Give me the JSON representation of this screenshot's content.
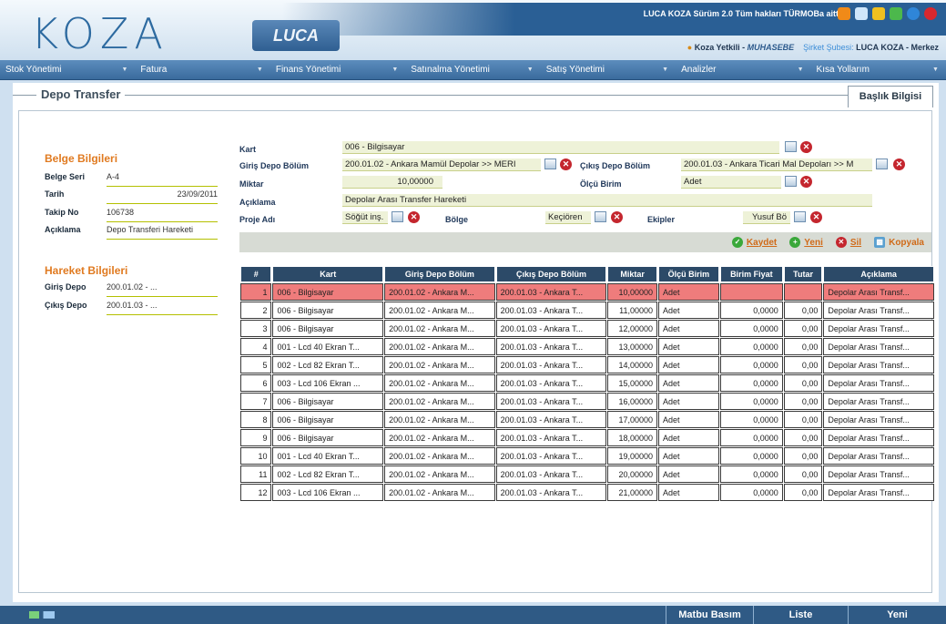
{
  "header": {
    "logo_text": "KOZA",
    "luca_text": "LUCA",
    "copyright": "LUCA KOZA Sürüm 2.0 Tüm hakları TÜRMOBa aittir.",
    "user_name": "Koza Yetkili",
    "user_role": "MUHASEBE",
    "branch_label": "Şirket Şubesi:",
    "branch_value": "LUCA KOZA - Merkez",
    "colors": {
      "brand": "#2d6aa0",
      "bar": "#2a5f95",
      "accent": "#e07a20",
      "selected_row": "#ef7c7c"
    }
  },
  "menu": [
    {
      "label": "Stok Yönetimi"
    },
    {
      "label": "Fatura"
    },
    {
      "label": "Finans Yönetimi"
    },
    {
      "label": "Satınalma Yönetimi"
    },
    {
      "label": "Satış Yönetimi"
    },
    {
      "label": "Analizler"
    },
    {
      "label": "Kısa Yollarım"
    }
  ],
  "page": {
    "title": "Depo Transfer",
    "header_tab": "Başlık Bilgisi"
  },
  "belge": {
    "section_title": "Belge Bilgileri",
    "seri_label": "Belge Seri",
    "seri_value": "A-4",
    "tarih_label": "Tarih",
    "tarih_value": "23/09/2011",
    "takip_label": "Takip No",
    "takip_value": "106738",
    "aciklama_label": "Açıklama",
    "aciklama_value": "Depo Transferi Hareketi"
  },
  "hareket": {
    "section_title": "Hareket Bilgileri",
    "giris_label": "Giriş Depo",
    "giris_value": "200.01.02 - ...",
    "cikis_label": "Çıkış Depo",
    "cikis_value": "200.01.03 - ..."
  },
  "form": {
    "kart_label": "Kart",
    "kart_value": "006 - Bilgisayar",
    "giris_label": "Giriş Depo Bölüm",
    "giris_value": "200.01.02 - Ankara Mamül Depolar >> MERI",
    "cikis_label": "Çıkış Depo Bölüm",
    "cikis_value": "200.01.03 - Ankara Ticari Mal Depoları >> M",
    "miktar_label": "Miktar",
    "miktar_value": "10,00000",
    "olcu_label": "Ölçü Birim",
    "olcu_value": "Adet",
    "aciklama_label": "Açıklama",
    "aciklama_value": "Depolar Arası Transfer Hareketi",
    "proje_label": "Proje Adı",
    "proje_value": "Söğüt inş.",
    "bolge_label": "Bölge",
    "bolge_value": "Keçiören",
    "ekip_label": "Ekipler",
    "ekip_value": "Yusuf Bö"
  },
  "actions": {
    "kaydet": "Kaydet",
    "yeni": "Yeni",
    "sil": "Sil",
    "kopyala": "Kopyala"
  },
  "table": {
    "columns": [
      "#",
      "Kart",
      "Giriş Depo Bölüm",
      "Çıkış Depo Bölüm",
      "Miktar",
      "Ölçü Birim",
      "Birim Fiyat",
      "Tutar",
      "Açıklama"
    ],
    "rows": [
      {
        "no": "1",
        "kart": "006 - Bilgisayar",
        "giris": "200.01.02 - Ankara M...",
        "cikis": "200.01.03 - Ankara T...",
        "miktar": "10,00000",
        "olcu": "Adet",
        "fiyat": "",
        "tutar": "",
        "aciklama": "Depolar Arası Transf..."
      },
      {
        "no": "2",
        "kart": "006 - Bilgisayar",
        "giris": "200.01.02 - Ankara M...",
        "cikis": "200.01.03 - Ankara T...",
        "miktar": "11,00000",
        "olcu": "Adet",
        "fiyat": "0,0000",
        "tutar": "0,00",
        "aciklama": "Depolar Arası Transf..."
      },
      {
        "no": "3",
        "kart": "006 - Bilgisayar",
        "giris": "200.01.02 - Ankara M...",
        "cikis": "200.01.03 - Ankara T...",
        "miktar": "12,00000",
        "olcu": "Adet",
        "fiyat": "0,0000",
        "tutar": "0,00",
        "aciklama": "Depolar Arası Transf..."
      },
      {
        "no": "4",
        "kart": "001 - Lcd 40 Ekran T...",
        "giris": "200.01.02 - Ankara M...",
        "cikis": "200.01.03 - Ankara T...",
        "miktar": "13,00000",
        "olcu": "Adet",
        "fiyat": "0,0000",
        "tutar": "0,00",
        "aciklama": "Depolar Arası Transf..."
      },
      {
        "no": "5",
        "kart": "002 - Lcd 82 Ekran T...",
        "giris": "200.01.02 - Ankara M...",
        "cikis": "200.01.03 - Ankara T...",
        "miktar": "14,00000",
        "olcu": "Adet",
        "fiyat": "0,0000",
        "tutar": "0,00",
        "aciklama": "Depolar Arası Transf..."
      },
      {
        "no": "6",
        "kart": "003 - Lcd 106 Ekran ...",
        "giris": "200.01.02 - Ankara M...",
        "cikis": "200.01.03 - Ankara T...",
        "miktar": "15,00000",
        "olcu": "Adet",
        "fiyat": "0,0000",
        "tutar": "0,00",
        "aciklama": "Depolar Arası Transf..."
      },
      {
        "no": "7",
        "kart": "006 - Bilgisayar",
        "giris": "200.01.02 - Ankara M...",
        "cikis": "200.01.03 - Ankara T...",
        "miktar": "16,00000",
        "olcu": "Adet",
        "fiyat": "0,0000",
        "tutar": "0,00",
        "aciklama": "Depolar Arası Transf..."
      },
      {
        "no": "8",
        "kart": "006 - Bilgisayar",
        "giris": "200.01.02 - Ankara M...",
        "cikis": "200.01.03 - Ankara T...",
        "miktar": "17,00000",
        "olcu": "Adet",
        "fiyat": "0,0000",
        "tutar": "0,00",
        "aciklama": "Depolar Arası Transf..."
      },
      {
        "no": "9",
        "kart": "006 - Bilgisayar",
        "giris": "200.01.02 - Ankara M...",
        "cikis": "200.01.03 - Ankara T...",
        "miktar": "18,00000",
        "olcu": "Adet",
        "fiyat": "0,0000",
        "tutar": "0,00",
        "aciklama": "Depolar Arası Transf..."
      },
      {
        "no": "10",
        "kart": "001 - Lcd 40 Ekran T...",
        "giris": "200.01.02 - Ankara M...",
        "cikis": "200.01.03 - Ankara T...",
        "miktar": "19,00000",
        "olcu": "Adet",
        "fiyat": "0,0000",
        "tutar": "0,00",
        "aciklama": "Depolar Arası Transf..."
      },
      {
        "no": "11",
        "kart": "002 - Lcd 82 Ekran T...",
        "giris": "200.01.02 - Ankara M...",
        "cikis": "200.01.03 - Ankara T...",
        "miktar": "20,00000",
        "olcu": "Adet",
        "fiyat": "0,0000",
        "tutar": "0,00",
        "aciklama": "Depolar Arası Transf..."
      },
      {
        "no": "12",
        "kart": "003 - Lcd 106 Ekran ...",
        "giris": "200.01.02 - Ankara M...",
        "cikis": "200.01.03 - Ankara T...",
        "miktar": "21,00000",
        "olcu": "Adet",
        "fiyat": "0,0000",
        "tutar": "0,00",
        "aciklama": "Depolar Arası Transf..."
      }
    ]
  },
  "footer": {
    "matbu": "Matbu Basım",
    "liste": "Liste",
    "yeni": "Yeni"
  }
}
